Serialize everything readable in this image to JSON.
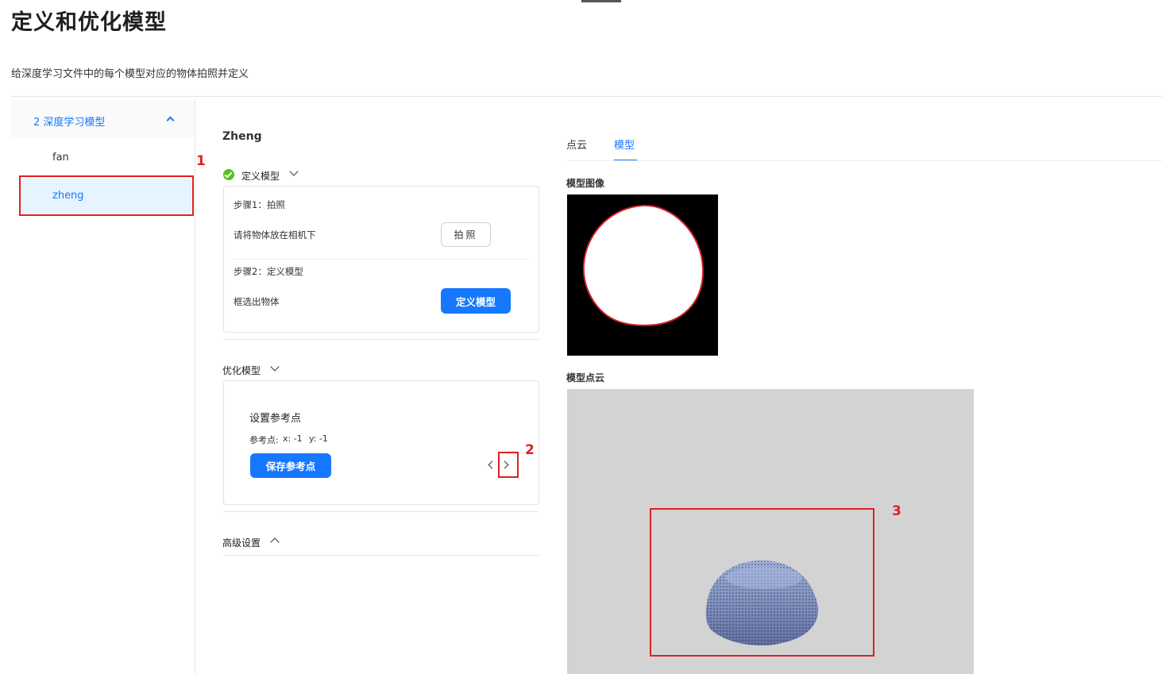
{
  "header": {
    "title": "定义和优化模型",
    "description": "给深度学习文件中的每个模型对应的物体拍照并定义"
  },
  "sidebar": {
    "group_label": "2 深度学习模型",
    "items": [
      {
        "label": "fan"
      },
      {
        "label": "zheng"
      }
    ]
  },
  "annotations": [
    "1",
    "2",
    "3"
  ],
  "object": {
    "title": "Zheng",
    "define_section": {
      "label": "定义模型",
      "step1_title": "步骤1：拍照",
      "step1_desc": "请将物体放在相机下",
      "step1_button": "拍照",
      "step2_title": "步骤2：定义模型",
      "step2_desc": "框选出物体",
      "step2_button": "定义模型"
    },
    "optimize_section": {
      "label": "优化模型",
      "card_title": "设置参考点",
      "ref_point_label": "参考点:",
      "ref_x": "x: -1",
      "ref_y": "y: -1",
      "save_button": "保存参考点"
    },
    "advanced_section": {
      "label": "高级设置"
    }
  },
  "tabs": [
    {
      "label": "点云",
      "active": false
    },
    {
      "label": "模型",
      "active": true
    }
  ],
  "model_view": {
    "image_label": "模型图像",
    "cloud_label": "模型点云"
  },
  "colors": {
    "primary": "#1677ff",
    "success": "#52c41a",
    "annotation": "#e02020"
  }
}
